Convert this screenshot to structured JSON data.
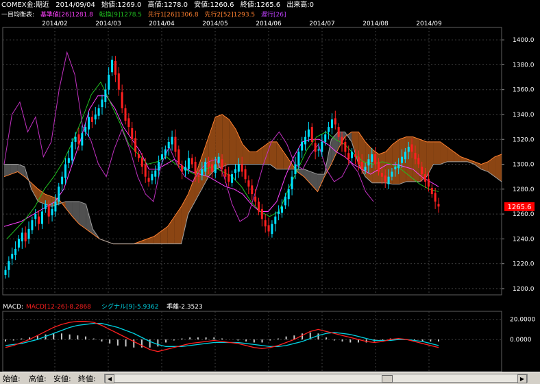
{
  "header": {
    "symbol": "COMEX金:期近",
    "date": "2014/09/04",
    "open_label": "始値:",
    "open": "1269.0",
    "high_label": "高値:",
    "high": "1278.0",
    "low_label": "安値:",
    "low": "1260.6",
    "close_label": "終値:",
    "close": "1265.6",
    "volume_label": "出来高:",
    "volume": "0"
  },
  "ichimoku_legend": {
    "title": "一目均衡表:",
    "kijun": "基準値[26]1281.8",
    "tenkan": "転換[9]1278.5",
    "senko1": "先行1[26]1306.8",
    "senko2": "先行2[52]1293.5",
    "chikou": "遅行[26]"
  },
  "macd_legend": {
    "title": "MACD:",
    "macd": "MACD[12-26]-8.2868",
    "signal": "シグナル[9]-5.9362",
    "divergence": "乖離-2.3523"
  },
  "status": {
    "open": "始値:",
    "high": "高値:",
    "low": "安値:",
    "close": "終値:"
  },
  "colors": {
    "up": "#00e0ff",
    "down": "#ff2020",
    "kijun": "#ff40ff",
    "tenkan": "#20c020",
    "senko1": "#ff8030",
    "senko2": "#a0a0a0",
    "chikou": "#c030c0",
    "macd": "#ff2020",
    "signal": "#00d0e0",
    "histogram": "#c8c8c8",
    "cloud_bull": "#8b4513",
    "cloud_bear": "#505050",
    "grid": "#404040",
    "last_price_bg": "#ff0000"
  },
  "chart_data": [
    {
      "type": "candlestick",
      "title": "COMEX金:期近",
      "x_ticks": [
        "2014/02",
        "2014/03",
        "2014/04",
        "2014/05",
        "2014/06",
        "2014/07",
        "2014/08",
        "2014/09"
      ],
      "y_ticks": [
        "1200.0",
        "1220.0",
        "1240.0",
        "1260.0",
        "1280.0",
        "1300.0",
        "1320.0",
        "1340.0",
        "1360.0",
        "1380.0",
        "1400.0"
      ],
      "ylim": [
        1195,
        1410
      ],
      "last_price": "1265.6",
      "close_series": [
        1215,
        1222,
        1228,
        1232,
        1240,
        1245,
        1238,
        1248,
        1255,
        1260,
        1252,
        1262,
        1268,
        1258,
        1264,
        1270,
        1282,
        1290,
        1300,
        1305,
        1318,
        1322,
        1316,
        1325,
        1330,
        1338,
        1334,
        1340,
        1345,
        1352,
        1360,
        1372,
        1384,
        1372,
        1360,
        1345,
        1335,
        1330,
        1320,
        1310,
        1305,
        1298,
        1290,
        1286,
        1292,
        1295,
        1302,
        1308,
        1312,
        1318,
        1322,
        1310,
        1300,
        1294,
        1298,
        1305,
        1300,
        1292,
        1290,
        1296,
        1302,
        1298,
        1294,
        1300,
        1306,
        1296,
        1290,
        1286,
        1292,
        1296,
        1300,
        1294,
        1288,
        1282,
        1276,
        1270,
        1262,
        1256,
        1250,
        1246,
        1252,
        1258,
        1262,
        1266,
        1274,
        1280,
        1290,
        1300,
        1310,
        1318,
        1322,
        1328,
        1318,
        1310,
        1312,
        1318,
        1324,
        1330,
        1336,
        1332,
        1322,
        1316,
        1310,
        1304,
        1310,
        1306,
        1300,
        1296,
        1298,
        1304,
        1308,
        1300,
        1294,
        1290,
        1286,
        1290,
        1294,
        1298,
        1300,
        1306,
        1310,
        1314,
        1310,
        1304,
        1300,
        1292,
        1286,
        1282,
        1276,
        1270,
        1266
      ],
      "senko1": [
        1290,
        1292,
        1294,
        1290,
        1285,
        1280,
        1276,
        1274,
        1272,
        1265,
        1258,
        1252,
        1248,
        1244,
        1240,
        1238,
        1236,
        1236,
        1236,
        1236,
        1238,
        1240,
        1242,
        1246,
        1250,
        1258,
        1266,
        1276,
        1290,
        1306,
        1322,
        1338,
        1340,
        1336,
        1328,
        1316,
        1310,
        1310,
        1314,
        1318,
        1318,
        1310,
        1302,
        1294,
        1290,
        1284,
        1278,
        1290,
        1300,
        1312,
        1322,
        1326,
        1326,
        1318,
        1312,
        1308,
        1310,
        1316,
        1320,
        1322,
        1322,
        1320,
        1318,
        1318,
        1318,
        1314,
        1310,
        1306,
        1304,
        1302,
        1300,
        1302,
        1306,
        1308
      ],
      "senko2": [
        1300,
        1300,
        1300,
        1298,
        1280,
        1270,
        1268,
        1266,
        1268,
        1270,
        1270,
        1270,
        1268,
        1248,
        1240,
        1238,
        1236,
        1236,
        1236,
        1236,
        1236,
        1236,
        1236,
        1236,
        1236,
        1236,
        1236,
        1260,
        1270,
        1280,
        1290,
        1296,
        1298,
        1300,
        1300,
        1300,
        1300,
        1300,
        1300,
        1300,
        1296,
        1296,
        1296,
        1296,
        1296,
        1294,
        1292,
        1292,
        1320,
        1326,
        1326,
        1318,
        1300,
        1290,
        1285,
        1285,
        1285,
        1284,
        1284,
        1286,
        1286,
        1286,
        1290,
        1300,
        1300,
        1302,
        1302,
        1302,
        1302,
        1300,
        1296,
        1294,
        1290,
        1286
      ],
      "kijun": [
        1250,
        1252,
        1254,
        1258,
        1262,
        1266,
        1270,
        1280,
        1300,
        1320,
        1344,
        1355,
        1355,
        1345,
        1330,
        1320,
        1310,
        1296,
        1296,
        1300,
        1304,
        1298,
        1294,
        1292,
        1290,
        1286,
        1282,
        1280,
        1276,
        1268,
        1262,
        1262,
        1270,
        1290,
        1306,
        1318,
        1320,
        1320,
        1316,
        1310,
        1306,
        1300,
        1296,
        1292,
        1296,
        1300,
        1300,
        1298,
        1296,
        1290,
        1286,
        1282
      ],
      "tenkan": [
        1240,
        1248,
        1256,
        1266,
        1280,
        1290,
        1302,
        1318,
        1336,
        1356,
        1366,
        1350,
        1334,
        1316,
        1308,
        1300,
        1302,
        1306,
        1300,
        1296,
        1292,
        1296,
        1298,
        1294,
        1290,
        1282,
        1270,
        1262,
        1258,
        1262,
        1280,
        1296,
        1312,
        1322,
        1326,
        1320,
        1316,
        1308,
        1302,
        1300,
        1302,
        1300,
        1296,
        1290,
        1284,
        1280,
        1278
      ],
      "chikou": [
        1300,
        1340,
        1350,
        1326,
        1338,
        1306,
        1318,
        1360,
        1390,
        1372,
        1330,
        1320,
        1300,
        1290,
        1312,
        1328,
        1312,
        1290,
        1276,
        1270,
        1300,
        1314,
        1300,
        1290,
        1286,
        1296,
        1302,
        1304,
        1290,
        1268,
        1254,
        1258,
        1278,
        1300,
        1318,
        1326,
        1316,
        1300,
        1296,
        1308,
        1316,
        1296,
        1286,
        1290,
        1302,
        1294,
        1278,
        1270
      ]
    },
    {
      "type": "macd",
      "y_ticks": [
        "20.0000",
        "0.0000"
      ],
      "ylim": [
        -32,
        28
      ],
      "macd": [
        -8,
        -6,
        -3,
        0,
        4,
        8,
        12,
        15,
        17,
        18,
        18,
        17,
        14,
        10,
        6,
        2,
        -2,
        -6,
        -10,
        -12,
        -10,
        -8,
        -6,
        -4,
        -3,
        -2,
        -1,
        -2,
        -3,
        -4,
        -6,
        -8,
        -9,
        -8,
        -6,
        -3,
        0,
        4,
        8,
        10,
        8,
        6,
        4,
        2,
        0,
        -2,
        -3,
        -2,
        0,
        1,
        0,
        -2,
        -4,
        -6,
        -8
      ],
      "signal": [
        -6,
        -5,
        -4,
        -2,
        0,
        3,
        6,
        9,
        12,
        14,
        15,
        16,
        16,
        14,
        12,
        9,
        6,
        2,
        -2,
        -5,
        -7,
        -7,
        -7,
        -6,
        -5,
        -4,
        -3,
        -3,
        -3,
        -3,
        -4,
        -5,
        -6,
        -7,
        -7,
        -6,
        -4,
        -2,
        1,
        4,
        6,
        7,
        6,
        5,
        3,
        1,
        -1,
        -1,
        -1,
        0,
        0,
        -1,
        -2,
        -4,
        -6
      ],
      "histogram": [
        -2,
        -1,
        1,
        2,
        4,
        5,
        6,
        6,
        5,
        4,
        3,
        1,
        -2,
        -4,
        -6,
        -7,
        -8,
        -8,
        -8,
        -7,
        -3,
        -1,
        1,
        2,
        2,
        2,
        2,
        1,
        0,
        -1,
        -2,
        -3,
        -3,
        -1,
        1,
        3,
        4,
        6,
        7,
        6,
        2,
        -1,
        -2,
        -3,
        -3,
        -3,
        -2,
        -1,
        1,
        1,
        0,
        -1,
        -2,
        -2,
        -2
      ]
    }
  ]
}
